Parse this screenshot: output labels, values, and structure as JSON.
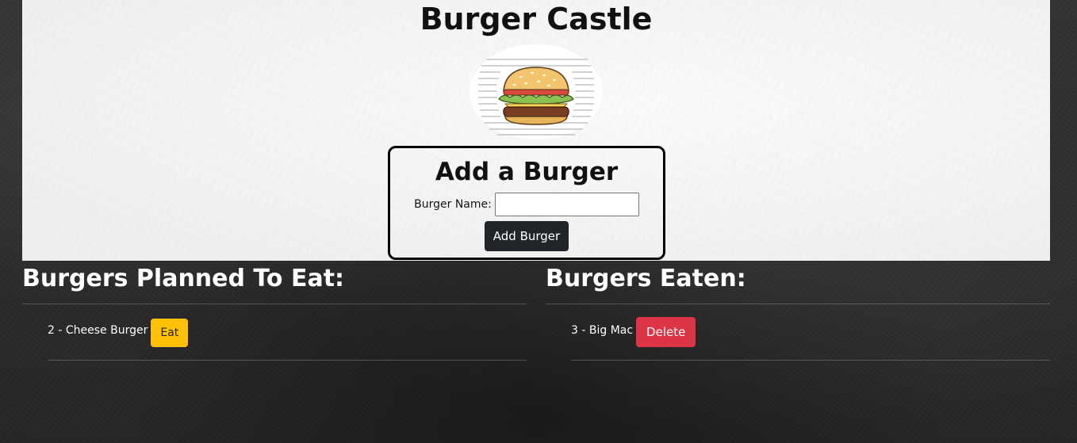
{
  "header": {
    "title": "Burger Castle"
  },
  "add_form": {
    "heading": "Add a Burger",
    "name_label": "Burger Name:",
    "name_value": "",
    "submit_label": "Add Burger"
  },
  "planned": {
    "title": "Burgers Planned To Eat:",
    "items": [
      {
        "text": "2 - Cheese Burger",
        "action_label": "Eat"
      }
    ]
  },
  "eaten": {
    "title": "Burgers Eaten:",
    "items": [
      {
        "text": "3 - Big Mac",
        "action_label": "Delete"
      }
    ]
  },
  "colors": {
    "eat_button": "#ffc107",
    "delete_button": "#dc3545",
    "add_button": "#212529"
  },
  "icons": {
    "logo": "burger-illustration"
  }
}
